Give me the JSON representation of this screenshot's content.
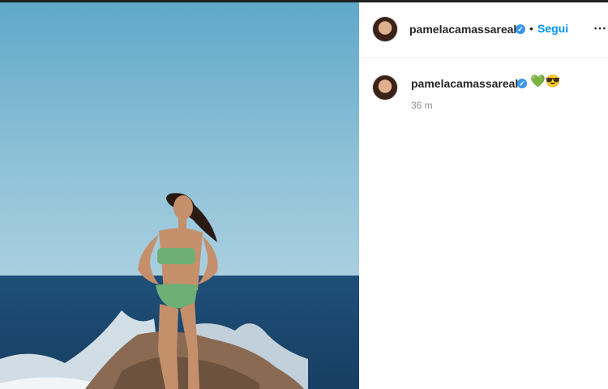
{
  "post": {
    "username": "pamelacamassareal",
    "follow_label": "Segui",
    "separator": "•",
    "more_icon": "⋯",
    "caption": "💚😎",
    "timestamp": "36 m"
  },
  "icons": {
    "verified": "✓"
  },
  "colors": {
    "follow": "#0095f6",
    "verified": "#3897f0",
    "timestamp": "#8e8e8e"
  }
}
